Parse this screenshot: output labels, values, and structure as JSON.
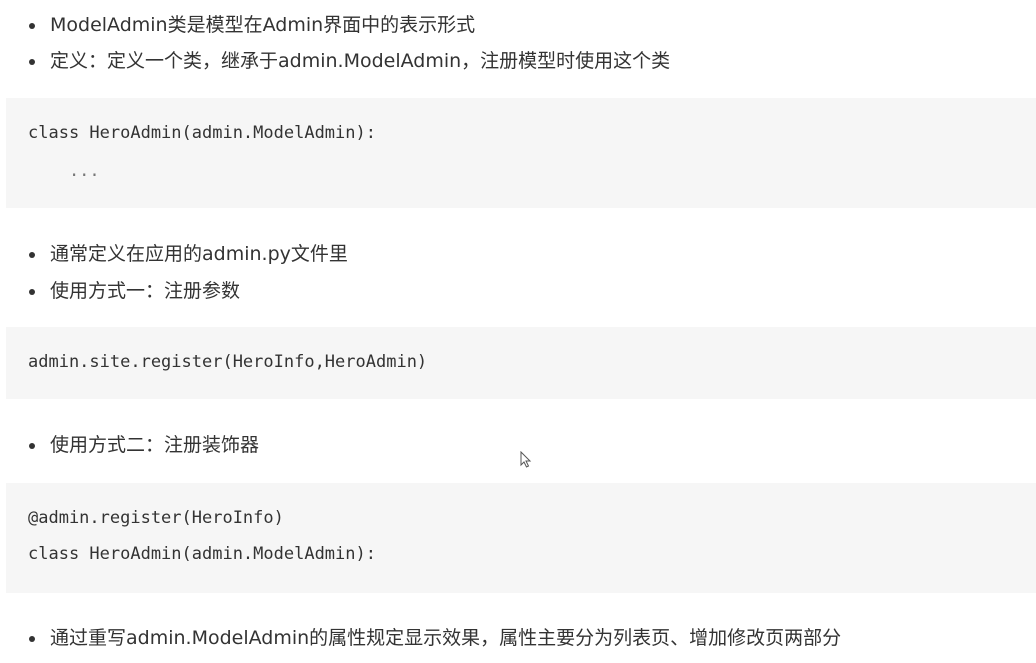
{
  "section1": {
    "bullets": [
      "ModelAdmin类是模型在Admin界面中的表示形式",
      "定义：定义一个类，继承于admin.ModelAdmin，注册模型时使用这个类"
    ]
  },
  "code1": {
    "lines": [
      "class HeroAdmin(admin.ModelAdmin):",
      "    ..."
    ]
  },
  "section2": {
    "bullets": [
      "通常定义在应用的admin.py文件里",
      "使用方式一：注册参数"
    ]
  },
  "code2": {
    "lines": [
      "admin.site.register(HeroInfo,HeroAdmin)"
    ]
  },
  "section3": {
    "bullets": [
      "使用方式二：注册装饰器"
    ]
  },
  "code3": {
    "lines": [
      "@admin.register(HeroInfo)",
      "class HeroAdmin(admin.ModelAdmin):"
    ]
  },
  "section4": {
    "bullets": [
      "通过重写admin.ModelAdmin的属性规定显示效果，属性主要分为列表页、增加修改页两部分"
    ]
  },
  "cursor": {
    "icon": "mouse-pointer-icon"
  }
}
